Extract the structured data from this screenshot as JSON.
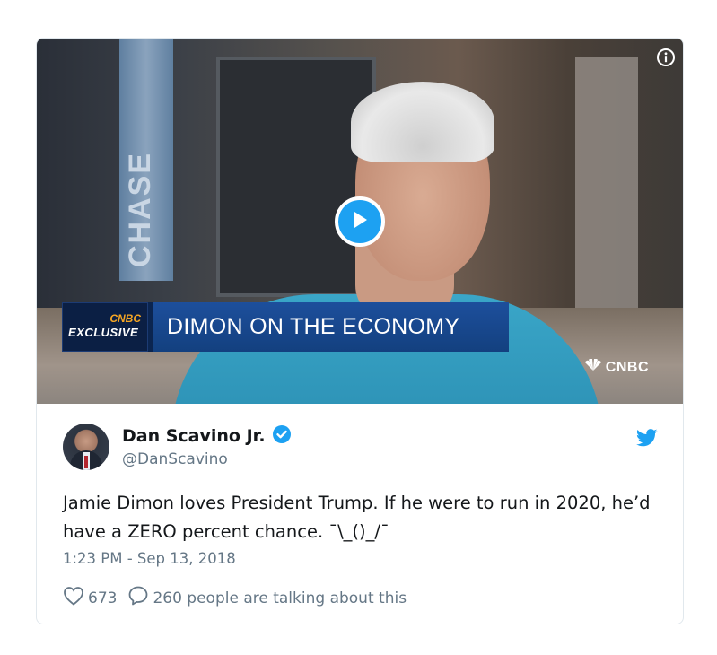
{
  "video": {
    "sign_text": "CHASE",
    "badge_network": "CNBC",
    "badge_label": "EXCLUSIVE",
    "headline": "DIMON ON THE ECONOMY",
    "watermark": "CNBC"
  },
  "tweet": {
    "display_name": "Dan Scavino Jr.",
    "handle": "@DanScavino",
    "text": "Jamie Dimon loves President Trump. If he were to run in 2020, he’d have a ZERO percent chance. ¯\\_()_/¯",
    "timestamp": "1:23 PM - Sep 13, 2018",
    "likes": "673",
    "conversation": "260 people are talking about this"
  },
  "colors": {
    "accent": "#1da1f2",
    "verified": "#1da1f2",
    "secondary_text": "#657786",
    "border": "#e1e8ed"
  },
  "icons": {
    "play": "play-icon",
    "info": "info-icon",
    "verified": "verified-badge-icon",
    "twitter": "twitter-bird-icon",
    "like": "heart-icon",
    "reply": "speech-bubble-icon"
  }
}
